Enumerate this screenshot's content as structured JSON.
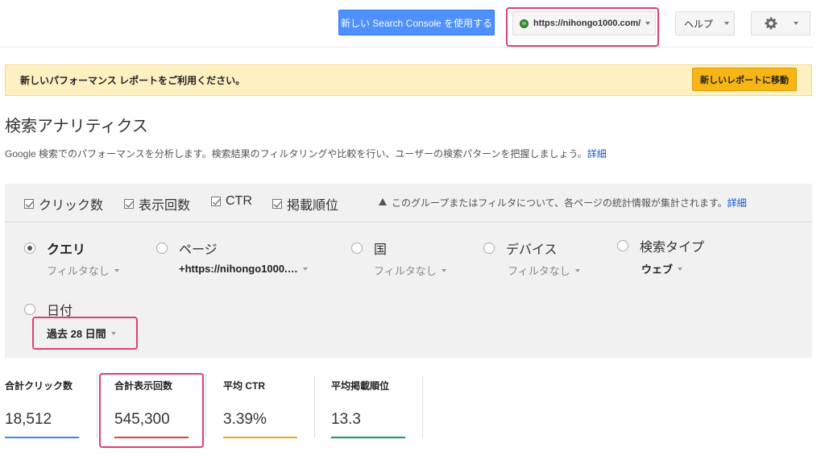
{
  "topbar": {
    "new_sc_label": "新しい Search Console を使用する",
    "site_url": "https://nihongo1000.com/",
    "help_label": "ヘルプ"
  },
  "banner": {
    "text": "新しいパフォーマンス レポートをご利用ください。",
    "button_label": "新しいレポートに移動"
  },
  "page": {
    "title": "検索アナリティクス",
    "description": "Google 検索でのパフォーマンスを分析します。検索結果のフィルタリングや比較を行い、ユーザーの検索パターンを把握しましょう。",
    "description_link": "詳細"
  },
  "metrics": [
    {
      "label": "クリック数",
      "checked": true
    },
    {
      "label": "表示回数",
      "checked": true
    },
    {
      "label": "CTR",
      "checked": true
    },
    {
      "label": "掲載順位",
      "checked": true
    }
  ],
  "info_note": {
    "text": "このグループまたはフィルタについて、各ページの統計情報が集計されます。",
    "link": "詳細"
  },
  "dimensions": [
    {
      "label": "クエリ",
      "filter": "フィルタなし",
      "selected": true
    },
    {
      "label": "ページ",
      "filter": "+https://nihongo1000.…",
      "selected": false
    },
    {
      "label": "国",
      "filter": "フィルタなし",
      "selected": false
    },
    {
      "label": "デバイス",
      "filter": "フィルタなし",
      "selected": false
    },
    {
      "label": "検索タイプ",
      "filter": "ウェブ",
      "selected": false
    },
    {
      "label": "日付",
      "filter": "過去 28 日間",
      "selected": false
    }
  ],
  "stats": [
    {
      "label": "合計クリック数",
      "value": "18,512",
      "color": "#4285f4"
    },
    {
      "label": "合計表示回数",
      "value": "545,300",
      "color": "#db4437"
    },
    {
      "label": "平均 CTR",
      "value": "3.39%",
      "color": "#f4a11d"
    },
    {
      "label": "平均掲載順位",
      "value": "13.3",
      "color": "#0f9d58"
    }
  ]
}
